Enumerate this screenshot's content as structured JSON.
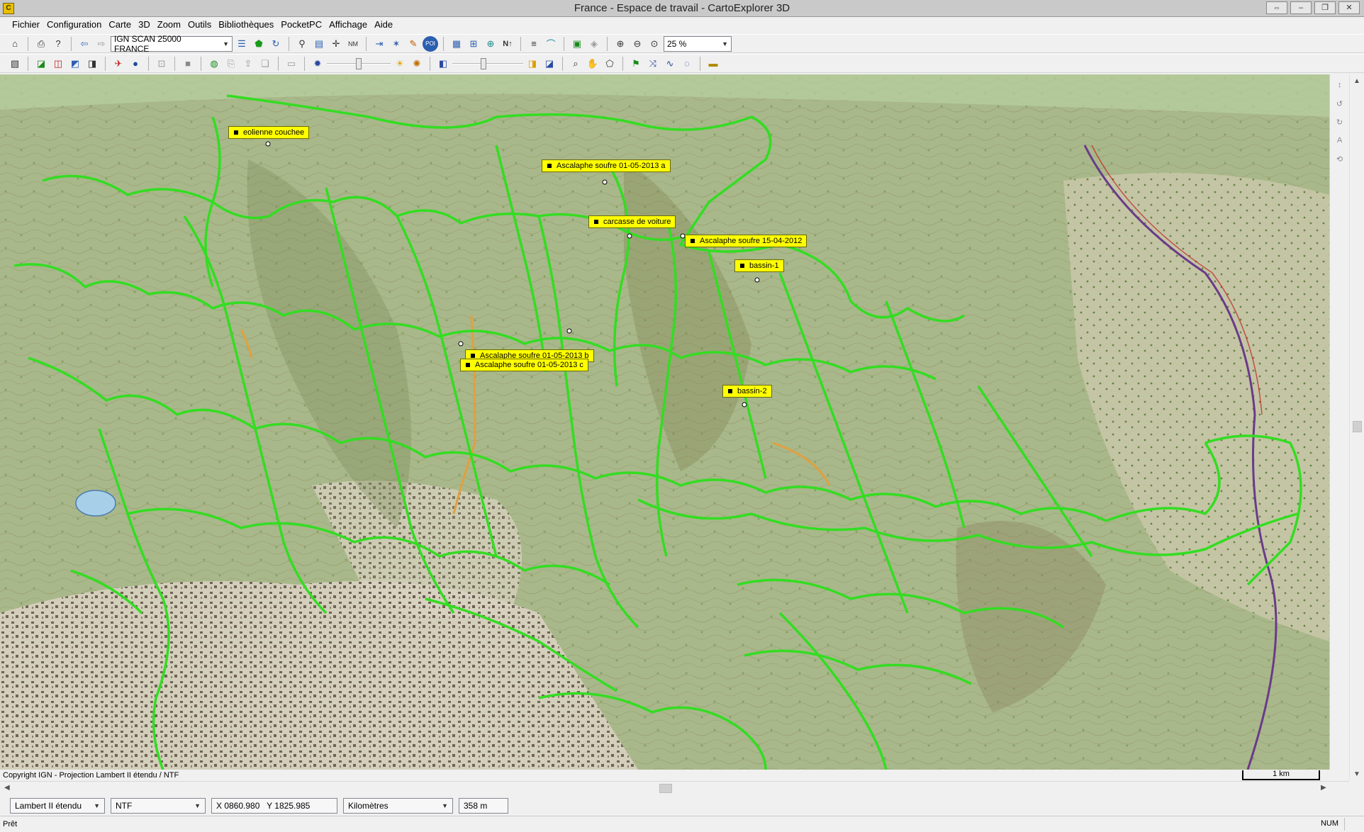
{
  "window": {
    "title": "France - Espace de travail - CartoExplorer 3D",
    "app_icon": "cartoexplorer-logo",
    "controls": [
      "restore-icon",
      "minimize-icon",
      "maximize-icon",
      "close-icon"
    ]
  },
  "menubar": {
    "items": [
      "Fichier",
      "Configuration",
      "Carte",
      "3D",
      "Zoom",
      "Outils",
      "Bibliothèques",
      "PocketPC",
      "Affichage",
      "Aide"
    ]
  },
  "toolbar1": {
    "map_layer_select": "IGN SCAN 25000 FRANCE",
    "zoom_select": "25 %"
  },
  "map": {
    "track_color": "#33dd22",
    "waypoint_color": "#ffff00",
    "waypoints": [
      {
        "label": "eolienne couchee"
      },
      {
        "label": "Ascalaphe soufre 01-05-2013 a"
      },
      {
        "label": "carcasse de voiture"
      },
      {
        "label": "Ascalaphe soufre 15-04-2012"
      },
      {
        "label": "bassin-1"
      },
      {
        "label": "Ascalaphe soufre 01-05-2013 b"
      },
      {
        "label": "Ascalaphe soufre 01-05-2013 c"
      },
      {
        "label": "bassin-2"
      }
    ],
    "copyright": "Copyright IGN - Projection Lambert II étendu / NTF",
    "scale_label": "1 km"
  },
  "coordbar": {
    "projection": "Lambert II étendu",
    "datum": "NTF",
    "coords": "X 0860.980   Y 1825.985",
    "units": "Kilomètres",
    "altitude": "358 m"
  },
  "statusbar": {
    "text": "Prêt",
    "num": "NUM"
  }
}
